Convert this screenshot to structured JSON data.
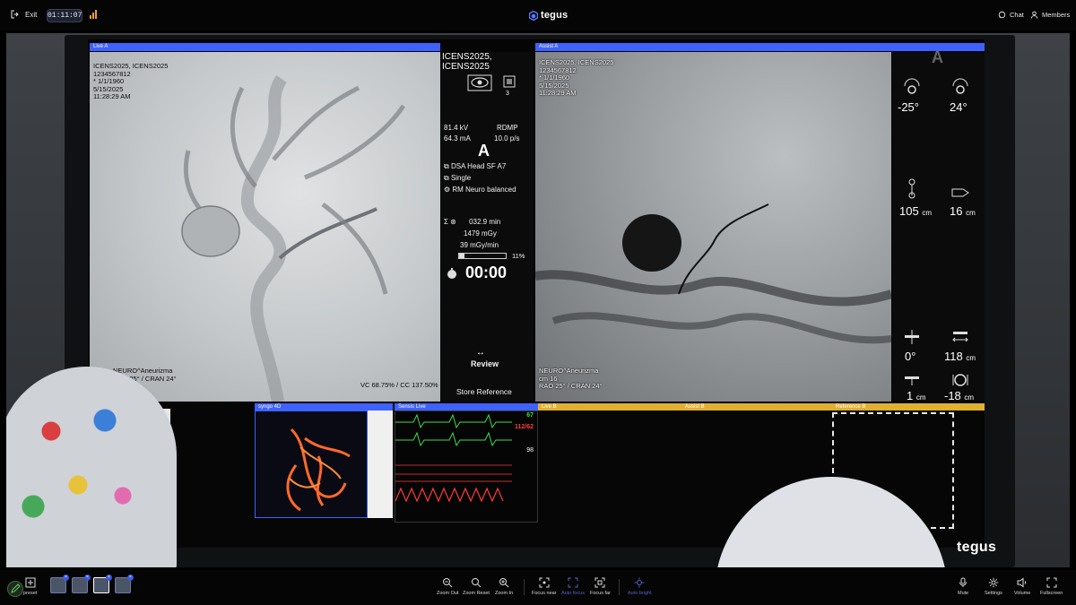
{
  "topbar": {
    "exit_label": "Exit",
    "timer": "01:11:07",
    "brand": "tegus",
    "chat_label": "Chat",
    "members_label": "Members"
  },
  "screen": {
    "live_a": {
      "title": "Live A",
      "patient": "ICENS2025, ICENS2025\n1234567812\n* 1/1/1960\n5/15/2025\n11:28:29 AM",
      "bottom_left": "NEURO^Aneurizma\nRAO 25° / CRAN 24°",
      "bottom_right": "VC 68.75% / CC 137.50%"
    },
    "info": {
      "name": "ICENS2025,\nICENS2025",
      "count": "3",
      "kv": "81.4 kV",
      "mode": "RDMP",
      "ma": "64.3 mA",
      "fps": "10.0 p/s",
      "plane": "A",
      "program": "DSA Head SF A7",
      "acq": "Single",
      "preset": "RM Neuro balanced",
      "fluoro_time": "032.9 min",
      "dose": "1479 mGy",
      "rate": "39 mGy/min",
      "dose_percent": "11%",
      "clock": "00:00",
      "review": "Review",
      "store_reference": "Store Reference"
    },
    "assist_a": {
      "title": "Assist A",
      "patient": "ICENS2025, ICENS2025\n1234567812\n* 1/1/1960\n5/15/2025\n11:28:29 AM",
      "bottom_left": "NEURO^Aneurizma\ncm 16\nRAO 25° / CRAN 24°"
    },
    "geometry": {
      "plane": "A",
      "angle1": "-25°",
      "angle2": "24°",
      "height": "105",
      "height_unit": "cm",
      "fd": "16",
      "fd_unit": "cm",
      "rot": "0°",
      "sid": "118",
      "sid_unit": "cm",
      "table": "1",
      "table_unit": "cm",
      "tilt": "-18",
      "tilt_unit": "cm"
    },
    "strip": {
      "syngo": "syngo 4D",
      "sensis": "Sensis Live",
      "live_b": "Live B",
      "assist_b": "Assist B",
      "reference_b": "Reference B",
      "hr": "67",
      "bp": "112/62",
      "spo2": "98"
    }
  },
  "watermark": "tegus",
  "toolbar": {
    "preset_label": "preset",
    "zoom_out": "Zoom Out",
    "zoom_reset": "Zoom Reset",
    "zoom_in": "Zoom In",
    "focus_near": "Focus near",
    "auto_focus": "Auto focus",
    "focus_far": "Focus far",
    "auto_bright": "Auto bright",
    "mute": "Mute",
    "settings": "Settings",
    "volume": "Volume",
    "fullscreen": "Fullscreen"
  },
  "colors": {
    "accent": "#2d4fd8",
    "live_b_bar": "#e0b030",
    "ecg_green": "#39e04a",
    "bp_red": "#ff3b3b"
  }
}
